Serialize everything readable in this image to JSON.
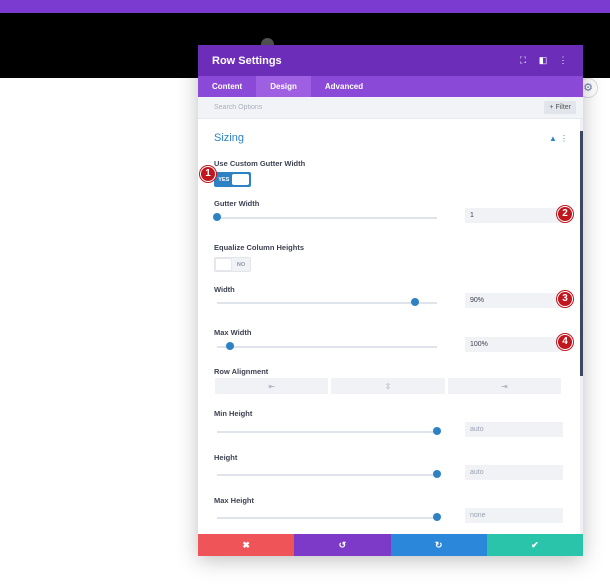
{
  "modal": {
    "title": "Row Settings",
    "icons": {
      "expand": "⛶",
      "snap": "◧",
      "more": "⋮"
    }
  },
  "tabs": [
    "Content",
    "Design",
    "Advanced"
  ],
  "search": {
    "placeholder": "Search Options",
    "filter_label": "+ Filter"
  },
  "section": {
    "title": "Sizing",
    "collapse_icon": "chevron-up",
    "more_icon": "⋮"
  },
  "fields": {
    "use_custom_gutter": {
      "label": "Use Custom Gutter Width",
      "value": "YES"
    },
    "gutter_width": {
      "label": "Gutter Width",
      "value": "1",
      "level": 0.0
    },
    "equalize": {
      "label": "Equalize Column Heights",
      "value": "NO"
    },
    "width": {
      "label": "Width",
      "value": "90%",
      "level": 0.9
    },
    "max_width": {
      "label": "Max Width",
      "value": "100%",
      "level": 0.06
    },
    "row_alignment": {
      "label": "Row Alignment",
      "options": [
        "⇤",
        "⇳",
        "⇥"
      ]
    },
    "min_height": {
      "label": "Min Height",
      "value": "auto",
      "level": 1.0
    },
    "height": {
      "label": "Height",
      "value": "auto",
      "level": 1.0
    },
    "max_height": {
      "label": "Max Height",
      "value": "none",
      "level": 1.0
    }
  },
  "footer": {
    "cancel": "✖",
    "undo": "↺",
    "redo": "↻",
    "save": "✔",
    "colors": {
      "cancel": "#ef5459",
      "undo": "#7d3ac8",
      "redo": "#2b87da",
      "save": "#29c4a9"
    }
  },
  "markers": [
    "1",
    "2",
    "3",
    "4"
  ],
  "colors": {
    "accent": "#2e82c4",
    "header": "#6c2eb9",
    "tabs": "#8a49d6",
    "marker": "#c0161e"
  }
}
